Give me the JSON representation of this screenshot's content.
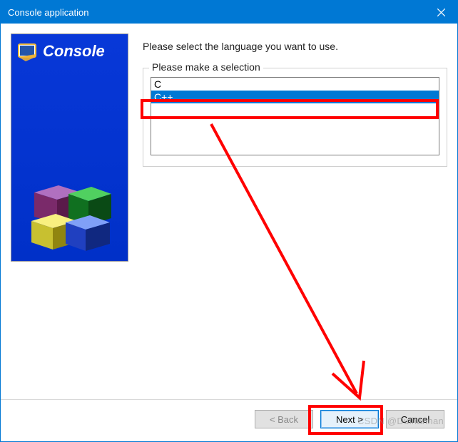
{
  "titlebar": {
    "title": "Console application"
  },
  "side": {
    "title": "Console"
  },
  "main": {
    "instruction": "Please select the language you want to use.",
    "group_label": "Please make a selection",
    "options": [
      {
        "label": "C",
        "selected": false
      },
      {
        "label": "C++",
        "selected": true
      }
    ]
  },
  "buttons": {
    "back": "< Back",
    "next": "Next >",
    "cancel": "Cancel"
  },
  "watermark": "CSDN @Duihannan"
}
